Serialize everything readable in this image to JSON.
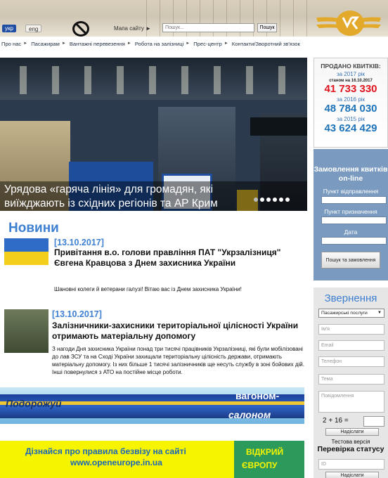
{
  "header": {
    "lang_active": "укр",
    "lang_alt": "eng",
    "sitemap": "Мапа сайту ►",
    "search_placeholder": "Пошук...",
    "search_button": "Пошук"
  },
  "nav": {
    "items": [
      "Про нас",
      "Пасажирам",
      "Вантажні перевезення",
      "Робота на залізниці",
      "Прес-центр",
      "Контакти/Зворотний зв'язок"
    ],
    "separator": "►"
  },
  "hero": {
    "caption": "Урядова «гаряча лінія» для громадян, які виїжджають із східних регіонів та АР Крим"
  },
  "sold": {
    "title": "ПРОДАНО КВИТКІВ:",
    "year2017": "за 2017 рік",
    "asof": "станом на 16.10.2017",
    "value2017": "41 733 330",
    "year2016": "за 2016 рік",
    "value2016": "48 784 030",
    "year2015": "за 2015 рік",
    "value2015": "43 624 429"
  },
  "tickets": {
    "heading": "Замовлення квитків on-line",
    "from_label": "Пункт відправлення",
    "to_label": "Пункт призначення",
    "date_label": "Дата",
    "button": "Пошук та замовлення"
  },
  "appeal": {
    "heading": "Звернення",
    "select_value": "Пасажирські послуги",
    "name_ph": "Ім'я",
    "email_ph": "Email",
    "phone_ph": "Телефон",
    "subject_ph": "Тема",
    "message_ph": "Повідомлення",
    "captcha": "2 + 16 =",
    "send": "Надіслати",
    "test_version": "Тестова версія",
    "status_heading": "Перевірка статусу",
    "id_ph": "ID",
    "send2": "Надіслати"
  },
  "news": {
    "heading": "Новини",
    "items": [
      {
        "date": "[13.10.2017]",
        "title": "Привітання в.о. голови правління ПАТ \"Укрзалізниця\" Євгена Кравцова з Днем захисника України",
        "body": "Шановні колеги й ветерани галузі! Вітаю вас із Днем захисника України!"
      },
      {
        "date": "[13.10.2017]",
        "title": "Залізничники-захисники територіальної цілісності України отримають матеріальну допомогу",
        "body": "З нагоди Дня захисника України понад три тисячі працівників Укрзалізниці, які були мобілізовані до лав ЗСУ та на Сході України захищали територіальну цілісність держави, отримають матеріальну допомогу. Із них більше 1 тисячі залізничників ще несуть службу в зоні бойових дій. Інші повернулися з АТО на постійне місце роботи."
      }
    ]
  },
  "banner1": {
    "word1": "Подорожуй",
    "word2": "вагоном-",
    "word3": "салоном"
  },
  "banner2": {
    "line1": "Дізнайся про правила безвізу на сайті",
    "line2": "www.openeurope.in.ua",
    "badge1": "ВІДКРИЙ",
    "badge2": "ЄВРОПУ"
  },
  "colors": {
    "brand": "#3d7fd1",
    "accent_red": "#e0141f",
    "accent_blue": "#1e73b8",
    "logo_gold": "#e3a92a"
  }
}
